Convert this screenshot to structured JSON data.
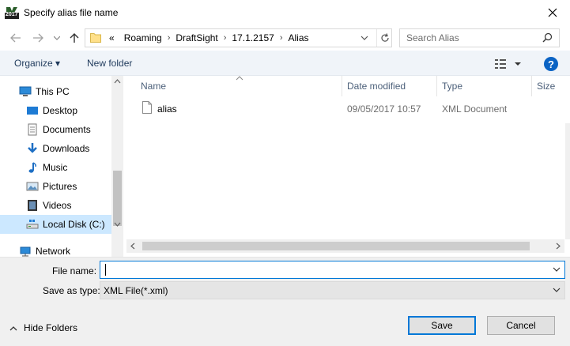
{
  "window": {
    "title": "Specify alias file name",
    "app_icon_text": "2017"
  },
  "address": {
    "overflow": "«",
    "crumbs": [
      "Roaming",
      "DraftSight",
      "17.1.2157",
      "Alias"
    ]
  },
  "search": {
    "placeholder": "Search Alias"
  },
  "toolbar": {
    "organize_label": "Organize ▾",
    "new_folder_label": "New folder",
    "help_label": "?"
  },
  "nav": {
    "items": [
      {
        "label": "This PC",
        "icon": "computer-icon"
      },
      {
        "label": "Desktop",
        "icon": "desktop-icon"
      },
      {
        "label": "Documents",
        "icon": "documents-icon"
      },
      {
        "label": "Downloads",
        "icon": "downloads-icon"
      },
      {
        "label": "Music",
        "icon": "music-icon"
      },
      {
        "label": "Pictures",
        "icon": "pictures-icon"
      },
      {
        "label": "Videos",
        "icon": "videos-icon"
      },
      {
        "label": "Local Disk (C:)",
        "icon": "drive-icon"
      },
      {
        "label": "Network",
        "icon": "network-icon"
      }
    ]
  },
  "files": {
    "columns": [
      "Name",
      "Date modified",
      "Type",
      "Size"
    ],
    "rows": [
      {
        "name": "alias",
        "date": "09/05/2017 10:57",
        "type": "XML Document",
        "size": ""
      }
    ]
  },
  "form": {
    "file_name_label": "File name:",
    "file_name_value": "",
    "save_type_label": "Save as type:",
    "save_type_value": "XML File(*.xml)"
  },
  "footer": {
    "hide_folders_label": "Hide Folders",
    "save_label": "Save",
    "cancel_label": "Cancel"
  },
  "colors": {
    "accent": "#0078d7",
    "selection": "#cce8ff",
    "toolbar_bg": "#f0f4f9"
  }
}
